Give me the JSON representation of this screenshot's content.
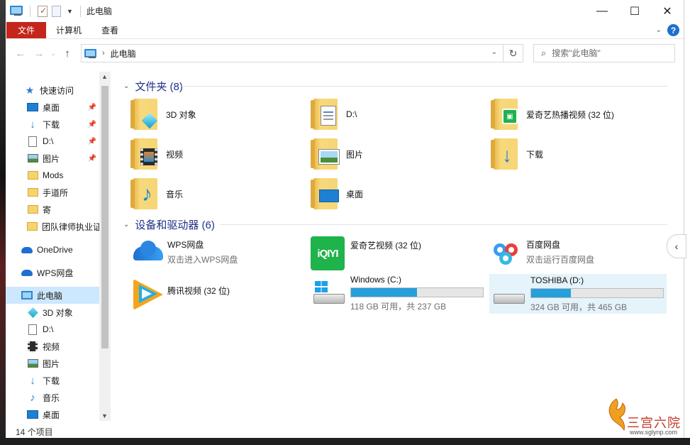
{
  "window": {
    "title": "此电脑",
    "controls": [
      "minimize",
      "maximize",
      "close"
    ]
  },
  "ribbon": {
    "tabs": [
      {
        "label": "文件",
        "active": true,
        "color": "#c4261b"
      },
      {
        "label": "计算机"
      },
      {
        "label": "查看"
      }
    ]
  },
  "address": {
    "crumb": "此电脑",
    "search_placeholder": "搜索\"此电脑\""
  },
  "sidebar": {
    "items": [
      {
        "label": "快速访问",
        "icon": "star-icon"
      },
      {
        "label": "桌面",
        "icon": "desktop-icon",
        "pinned": true
      },
      {
        "label": "下载",
        "icon": "download-icon",
        "pinned": true
      },
      {
        "label": "D:\\",
        "icon": "document-icon",
        "pinned": true
      },
      {
        "label": "图片",
        "icon": "pictures-icon",
        "pinned": true
      },
      {
        "label": "Mods",
        "icon": "folder-icon"
      },
      {
        "label": "手道所",
        "icon": "folder-icon"
      },
      {
        "label": "寄",
        "icon": "folder-icon"
      },
      {
        "label": "团队律师执业证",
        "icon": "folder-icon"
      },
      {
        "label": "OneDrive",
        "icon": "cloud-icon"
      },
      {
        "label": "WPS网盘",
        "icon": "cloud-icon"
      },
      {
        "label": "此电脑",
        "icon": "pc-icon",
        "selected": true
      },
      {
        "label": "3D 对象",
        "icon": "cube-icon"
      },
      {
        "label": "D:\\",
        "icon": "document-icon"
      },
      {
        "label": "视频",
        "icon": "film-icon"
      },
      {
        "label": "图片",
        "icon": "pictures-icon"
      },
      {
        "label": "下载",
        "icon": "download-icon"
      },
      {
        "label": "音乐",
        "icon": "music-icon"
      },
      {
        "label": "桌面",
        "icon": "desktop-icon"
      }
    ]
  },
  "status": {
    "count": "14 个项目"
  },
  "folders": {
    "header": "文件夹 (8)",
    "items": [
      {
        "label": "3D 对象",
        "icon": "cube-folder-icon"
      },
      {
        "label": "D:\\",
        "icon": "document-folder-icon"
      },
      {
        "label": "爱奇艺热播视频 (32 位)",
        "icon": "iqiyi-folder-icon"
      },
      {
        "label": "视频",
        "icon": "video-folder-icon"
      },
      {
        "label": "图片",
        "icon": "picture-folder-icon"
      },
      {
        "label": "下载",
        "icon": "download-folder-icon"
      },
      {
        "label": "音乐",
        "icon": "music-folder-icon"
      },
      {
        "label": "桌面",
        "icon": "desktop-folder-icon"
      }
    ]
  },
  "devices": {
    "header": "设备和驱动器 (6)",
    "items": [
      {
        "label": "WPS网盘",
        "sub": "双击进入WPS网盘",
        "icon": "wps-cloud-icon"
      },
      {
        "label": "爱奇艺视频 (32 位)",
        "icon": "iqiyi-app-icon"
      },
      {
        "label": "百度网盘",
        "sub": "双击运行百度网盘",
        "icon": "baidu-netdisk-icon"
      },
      {
        "label": "腾讯视频 (32 位)",
        "icon": "tencent-video-icon"
      },
      {
        "label": "Windows (C:)",
        "free": "118 GB 可用，共 237 GB",
        "used_fraction": 0.502,
        "icon": "windows-drive-icon"
      },
      {
        "label": "TOSHIBA (D:)",
        "free": "324 GB 可用，共 465 GB",
        "used_fraction": 0.303,
        "icon": "drive-icon",
        "selected": true
      }
    ]
  },
  "watermark": {
    "title": "三宫六院",
    "url": "www.sglynp.com"
  }
}
